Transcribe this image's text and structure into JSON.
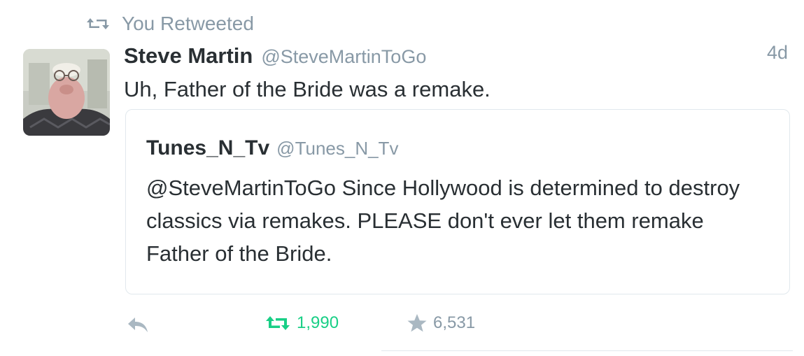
{
  "context": {
    "icon": "retweet-icon",
    "label": "You Retweeted"
  },
  "tweet": {
    "avatar_icon": "avatar",
    "fullname": "Steve Martin",
    "handle": "@SteveMartinToGo",
    "timestamp": "4d",
    "text": "Uh, Father of the Bride was a remake."
  },
  "quote": {
    "fullname": "Tunes_N_Tv",
    "handle": "@Tunes_N_Tv",
    "text": "@SteveMartinToGo Since Hollywood is determined to destroy classics via remakes.  PLEASE don't ever let them remake Father of the Bride."
  },
  "actions": {
    "reply_icon": "reply-icon",
    "retweet_icon": "retweet-icon",
    "retweet_count": "1,990",
    "favorite_icon": "star-icon",
    "favorite_count": "6,531"
  },
  "colors": {
    "muted": "#8899a6",
    "text": "#292f33",
    "retweet_active": "#19cf86",
    "border": "#e1e8ed"
  }
}
